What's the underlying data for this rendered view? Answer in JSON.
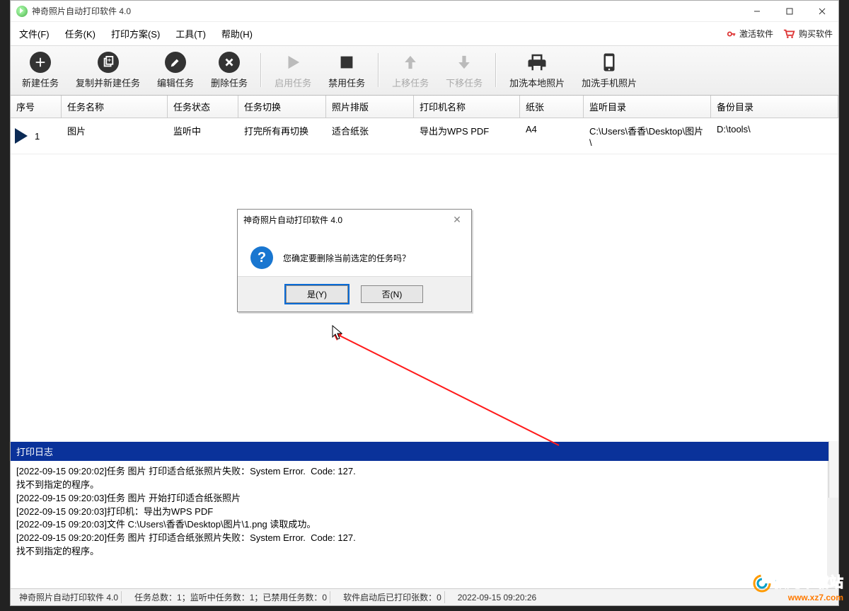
{
  "window": {
    "title": "神奇照片自动打印软件 4.0"
  },
  "menu": {
    "file": "文件(F)",
    "tasks": "任务(K)",
    "scheme": "打印方案(S)",
    "tools": "工具(T)",
    "help": "帮助(H)",
    "activate": "激活软件",
    "purchase": "购买软件"
  },
  "toolbar": {
    "new_task": "新建任务",
    "copy_new": "复制并新建任务",
    "edit": "编辑任务",
    "delete": "删除任务",
    "enable": "启用任务",
    "disable": "禁用任务",
    "move_up": "上移任务",
    "move_down": "下移任务",
    "add_local": "加洗本地照片",
    "add_phone": "加洗手机照片"
  },
  "table": {
    "headers": {
      "index": "序号",
      "name": "任务名称",
      "state": "任务状态",
      "switch": "任务切换",
      "layout": "照片排版",
      "printer": "打印机名称",
      "paper": "纸张",
      "watch": "监听目录",
      "backup": "备份目录"
    },
    "rows": [
      {
        "index": "1",
        "name": "图片",
        "state": "监听中",
        "switch": "打完所有再切换",
        "layout": "适合纸张",
        "printer": "导出为WPS PDF",
        "paper": "A4",
        "watch": "C:\\Users\\香香\\Desktop\\图片\\",
        "backup": "D:\\tools\\"
      }
    ]
  },
  "dialog": {
    "title": "神奇照片自动打印软件 4.0",
    "message": "您确定要删除当前选定的任务吗？",
    "yes": "是(Y)",
    "no": "否(N)"
  },
  "log": {
    "title": "打印日志",
    "lines": [
      "[2022-09-15 09:20:02]任务 图片 打印适合纸张照片失败：System Error.  Code: 127.",
      "找不到指定的程序。",
      "",
      "[2022-09-15 09:20:03]任务 图片 开始打印适合纸张照片",
      "[2022-09-15 09:20:03]打印机：导出为WPS PDF",
      "[2022-09-15 09:20:03]文件 C:\\Users\\香香\\Desktop\\图片\\1.png 读取成功。",
      "[2022-09-15 09:20:20]任务 图片 打印适合纸张照片失败：System Error.  Code: 127.",
      "找不到指定的程序。"
    ]
  },
  "status": {
    "app": "神奇照片自动打印软件 4.0",
    "totals": "任务总数：1；监听中任务数：1；已禁用任务数：0",
    "printed": "软件启动后已打印张数：0",
    "datetime": "2022-09-15 09:20:26"
  },
  "watermark": {
    "brand": "极光下载站",
    "url": "www.xz7.com"
  }
}
